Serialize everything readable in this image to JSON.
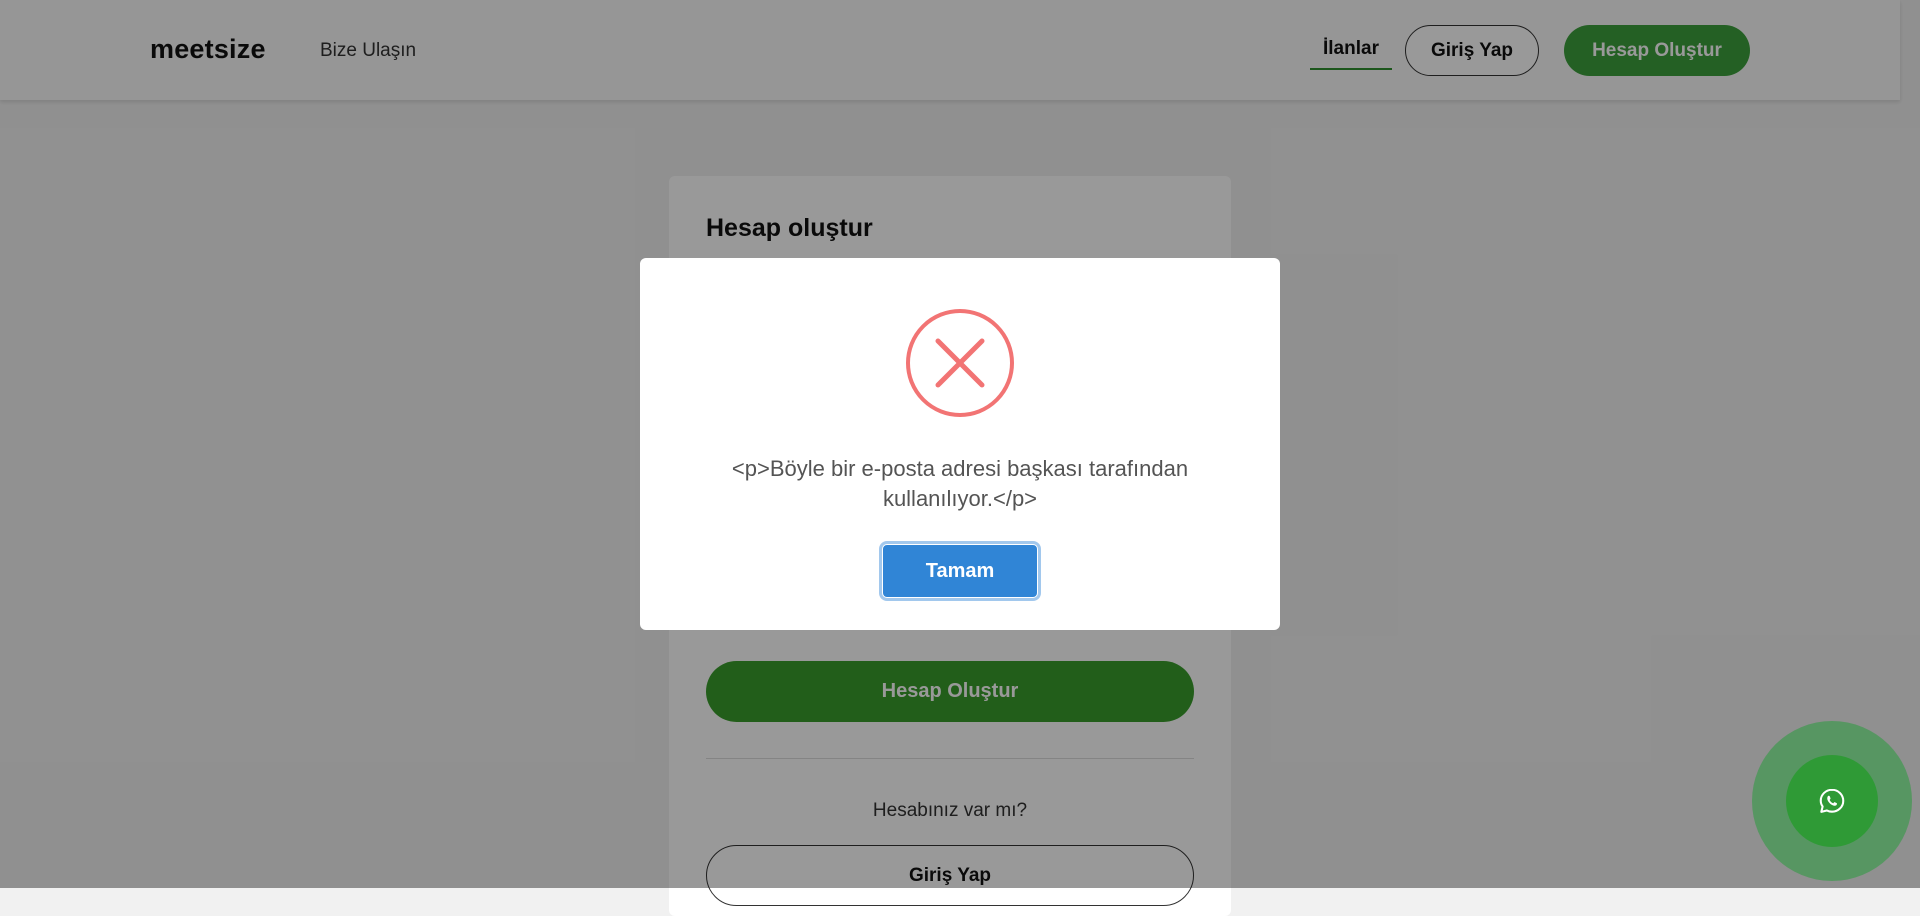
{
  "navbar": {
    "logo": "meetsize",
    "contact_link": "Bize Ulaşın",
    "listings_link": "İlanlar",
    "login_button": "Giriş Yap",
    "register_button": "Hesap Oluştur"
  },
  "form": {
    "title": "Hesap oluştur",
    "register_button": "Hesap Oluştur",
    "have_account_text": "Hesabınız var mı?",
    "login_button": "Giriş Yap"
  },
  "modal": {
    "icon": "error-x-icon",
    "message": "<p>Böyle bir e-posta adresi başkası tarafından kullanılıyor.</p>",
    "ok_button": "Tamam"
  },
  "floating": {
    "icon": "whatsapp-icon"
  },
  "colors": {
    "brand_green": "#3ca13c",
    "modal_button_blue": "#3085d6",
    "error_red": "#f27474"
  }
}
